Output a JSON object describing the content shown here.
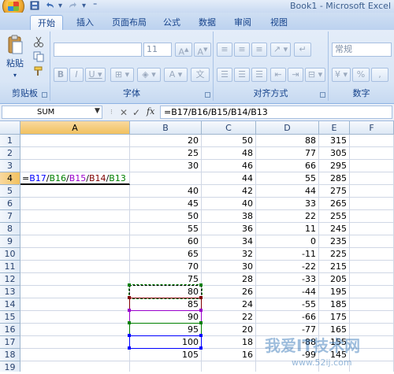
{
  "title_bar": {
    "title": "Book1 - Microsoft Excel",
    "quick_access": [
      "save-icon",
      "undo-icon",
      "redo-icon",
      "customize-icon"
    ]
  },
  "ribbon_tabs": [
    "开始",
    "插入",
    "页面布局",
    "公式",
    "数据",
    "审阅",
    "视图"
  ],
  "active_tab": "开始",
  "ribbon": {
    "clipboard": {
      "paste_label": "粘贴",
      "group_label": "剪贴板"
    },
    "font": {
      "font_size": "11",
      "group_label": "字体"
    },
    "alignment": {
      "group_label": "对齐方式"
    },
    "number": {
      "format": "常规",
      "percent": "%",
      "comma": ",",
      "group_label": "数字"
    }
  },
  "formula_bar": {
    "name_box": "SUM",
    "fx_label": "fx",
    "formula": "=B17/B16/B15/B14/B13"
  },
  "columns": [
    "A",
    "B",
    "C",
    "D",
    "E",
    "F"
  ],
  "rows": [
    "1",
    "2",
    "3",
    "4",
    "5",
    "6",
    "7",
    "8",
    "9",
    "10",
    "11",
    "12",
    "13",
    "14",
    "15",
    "16",
    "17",
    "18",
    "19"
  ],
  "cells": {
    "B": [
      "20",
      "25",
      "30",
      "",
      "40",
      "45",
      "50",
      "55",
      "60",
      "65",
      "70",
      "75",
      "80",
      "85",
      "90",
      "95",
      "100",
      "105",
      ""
    ],
    "C": [
      "50",
      "48",
      "46",
      "44",
      "42",
      "40",
      "38",
      "36",
      "34",
      "32",
      "30",
      "28",
      "26",
      "24",
      "22",
      "20",
      "18",
      "16",
      ""
    ],
    "D": [
      "88",
      "77",
      "66",
      "55",
      "44",
      "33",
      "22",
      "11",
      "0",
      "-11",
      "-22",
      "-33",
      "-44",
      "-55",
      "-66",
      "-77",
      "-88",
      "-99",
      ""
    ],
    "E": [
      "315",
      "305",
      "295",
      "285",
      "275",
      "265",
      "255",
      "245",
      "235",
      "225",
      "215",
      "205",
      "195",
      "185",
      "175",
      "165",
      "155",
      "145",
      ""
    ]
  },
  "editing_cell": {
    "address": "A4",
    "parts": [
      "=",
      "B17",
      "/",
      "B16",
      "/",
      "B15",
      "/",
      "B14",
      "/",
      "B13"
    ]
  },
  "reference_colors": {
    "B17": "#0000ff",
    "B16": "#008000",
    "B15": "#9900cc",
    "B14": "#800000",
    "B13": "#008000"
  },
  "watermark_text": "我爱IT技术网",
  "watermark_url": "www.52ij.com"
}
